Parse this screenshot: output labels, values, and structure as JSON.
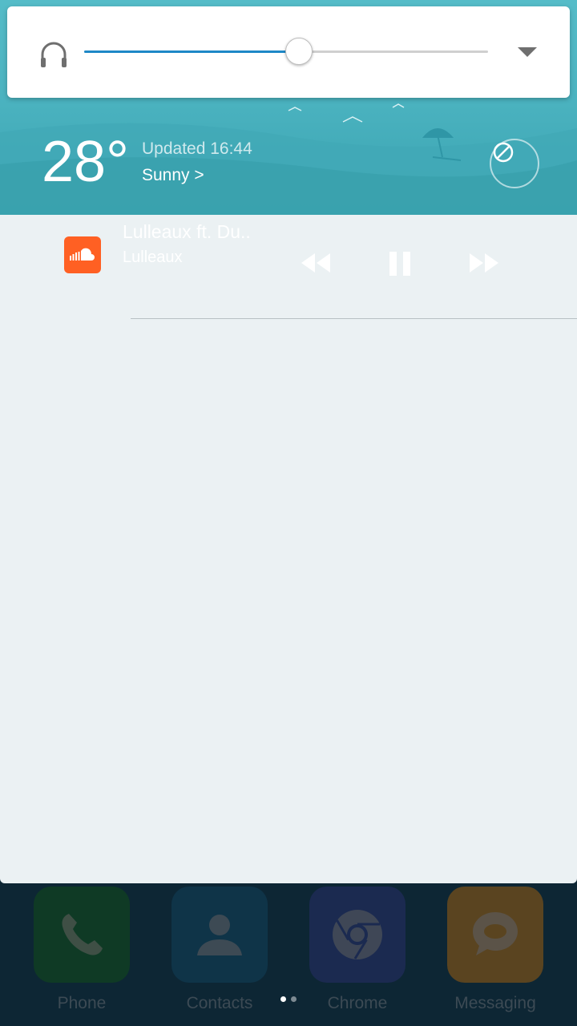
{
  "volume": {
    "level": 0.53,
    "icon": "headphones-icon",
    "expand_icon": "chevron-down-icon"
  },
  "weather": {
    "temperature": "28°",
    "updated": "Updated 16:44",
    "condition": "Sunny >",
    "action_icon": "do-not-disturb-icon"
  },
  "notification": {
    "app_icon": "soundcloud-icon",
    "title": "Lulleaux ft. Du..",
    "artist": "Lulleaux",
    "controls": [
      "rewind-icon",
      "pause-icon",
      "fast-forward-icon"
    ]
  },
  "dock": {
    "apps": [
      {
        "label": "Phone",
        "icon": "phone-icon",
        "color": "#0f3a25"
      },
      {
        "label": "Contacts",
        "icon": "contacts-icon",
        "color": "#0f3448"
      },
      {
        "label": "Chrome",
        "icon": "chrome-icon",
        "color": "#1b2a50"
      },
      {
        "label": "Messaging",
        "icon": "messaging-icon",
        "color": "#5a4420"
      }
    ]
  },
  "colors": {
    "accent": "#1e88c7",
    "weather_teal": "#4bb3c0",
    "soundcloud": "#ff6023",
    "shade_bg": "#ebf1f3"
  }
}
